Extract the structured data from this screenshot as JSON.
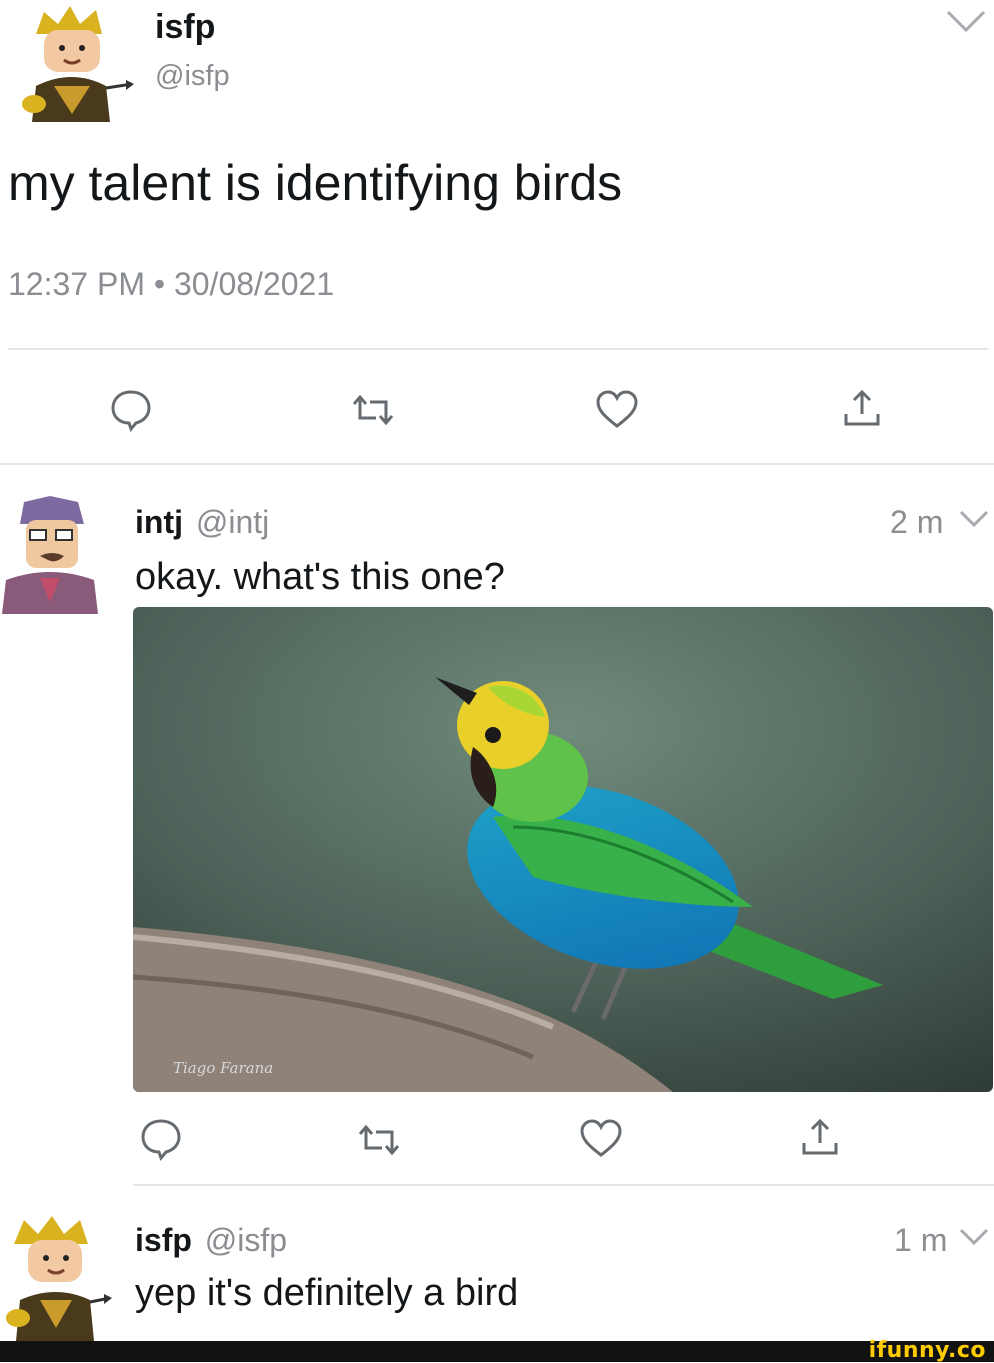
{
  "main_tweet": {
    "name": "isfp",
    "handle": "@isfp",
    "text": "my talent is identifying birds",
    "timestamp": "12:37 PM • 30/08/2021"
  },
  "reply1": {
    "name": "intj",
    "handle": "@intj",
    "time": "2 m",
    "text": "okay. what's this one?",
    "watermark": "Tiago Farana"
  },
  "reply2": {
    "name": "isfp",
    "handle": "@isfp",
    "time": "1 m",
    "text": "yep it's definitely a bird"
  },
  "footer": {
    "brand": "ifunny.co"
  },
  "colors": {
    "text": "#14171a",
    "muted": "#8a8d91",
    "divider": "#e3e5e8",
    "brand_yellow": "#ffcc00"
  }
}
